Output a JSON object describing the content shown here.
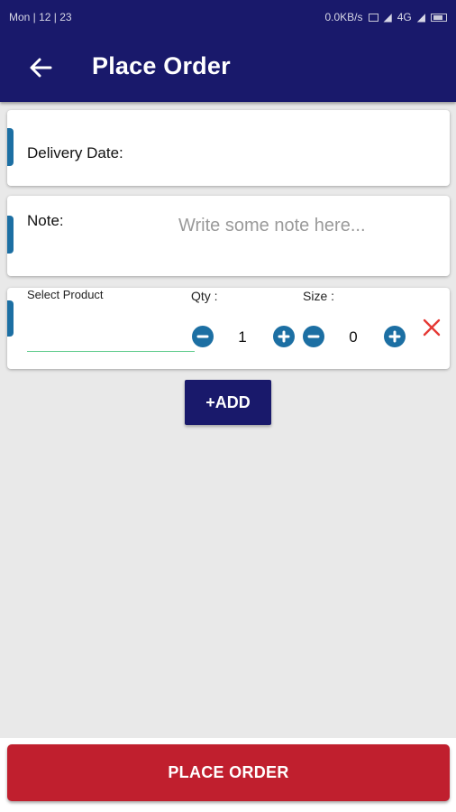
{
  "status_bar": {
    "time": "Mon | 12 | 23",
    "network_speed": "0.0KB/s",
    "network_type": "4G"
  },
  "header": {
    "title": "Place Order",
    "back_icon": "arrow-left-icon"
  },
  "delivery": {
    "label": "Delivery Date:"
  },
  "note": {
    "label": "Note:",
    "placeholder": "Write some note here..."
  },
  "product_row": {
    "select_label": "Select Product",
    "qty_label": "Qty :",
    "qty_value": "1",
    "size_label": "Size :",
    "size_value": "0",
    "remove_icon": "close-icon"
  },
  "add_button": {
    "label": "+ADD"
  },
  "place_order_button": {
    "label": "PLACE ORDER"
  },
  "colors": {
    "primary": "#19196b",
    "accent": "#1c6fa3",
    "danger": "#c01f2e",
    "remove": "#e53935",
    "underline": "#5ecb8b"
  }
}
